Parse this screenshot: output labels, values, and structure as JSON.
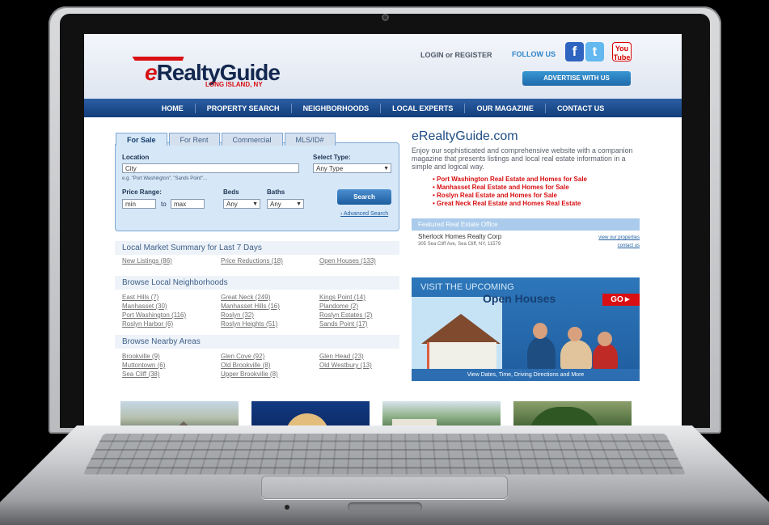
{
  "site": {
    "logo": {
      "brand_e": "e",
      "brand_main": "RealtyGuide",
      "subtitle": "LONG ISLAND, NY"
    },
    "header": {
      "login": "LOGIN",
      "or": "or",
      "register": "REGISTER",
      "follow_us": "FOLLOW US",
      "facebook_icon": "f",
      "twitter_icon": "t",
      "youtube_icon": "You Tube",
      "advertise": "ADVERTISE WITH US"
    },
    "nav": [
      "HOME",
      "PROPERTY SEARCH",
      "NEIGHBORHOODS",
      "LOCAL EXPERTS",
      "OUR MAGAZINE",
      "CONTACT US"
    ],
    "search": {
      "tabs": [
        "For Sale",
        "For Rent",
        "Commercial",
        "MLS/ID#"
      ],
      "location_label": "Location",
      "location_value": "City",
      "location_hint": "e.g. \"Port Washington\", \"Sands Point\"...",
      "type_label": "Select Type:",
      "type_value": "Any Type",
      "price_label": "Price Range:",
      "min": "min",
      "to": "to",
      "max": "max",
      "beds_label": "Beds",
      "beds_value": "Any",
      "baths_label": "Baths",
      "baths_value": "Any",
      "button": "Search",
      "advanced": "› Advanced Search"
    },
    "market": {
      "title": "Local Market Summary for Last 7 Days",
      "links": [
        "New Listings (86)",
        "Price Reductions (18)",
        "Open Houses (133)"
      ]
    },
    "neighborhoods": {
      "title": "Browse Local Neighborhoods",
      "links": [
        "East Hills (7)",
        "Great Neck (249)",
        "Kings Point (14)",
        "Manhasset (30)",
        "Manhasset Hills (16)",
        "Plandome (2)",
        "Port Washington (116)",
        "Roslyn (32)",
        "Roslyn Estates (2)",
        "Roslyn Harbor (6)",
        "Roslyn Heights (51)",
        "Sands Point (17)"
      ]
    },
    "nearby": {
      "title": "Browse Nearby Areas",
      "links": [
        "Brookville (9)",
        "Glen Cove (92)",
        "Glen Head (23)",
        "Muttontown (6)",
        "Old Brookville (8)",
        "Old Westbury (13)",
        "Sea Cliff (38)",
        "Upper Brookville (8)"
      ]
    },
    "intro": {
      "title": "eRealtyGuide.com",
      "text": "Enjoy our sophisticated and comprehensive website with a companion magazine that presents listings and local real estate information in a simple and logical way.",
      "links": [
        "Port Washington Real Estate and Homes for Sale",
        "Manhasset Real Estate and Homes for Sale",
        "Roslyn Real Estate and Homes for Sale",
        "Great Neck Real Estate and Homes Real Estate"
      ]
    },
    "featured": {
      "title": "Featured Real Estate Office",
      "agent": "Sherlock Homes Realty Corp",
      "address": "305 Sea Cliff Ave, Sea Cliff, NY, 11579",
      "view_properties": "view our properties",
      "contact": "contact us"
    },
    "banner": {
      "line1": "VISIT THE UPCOMING",
      "line2": "Open Houses",
      "go": "GO►",
      "footer": "View Dates, Time, Driving Directions and More"
    }
  }
}
